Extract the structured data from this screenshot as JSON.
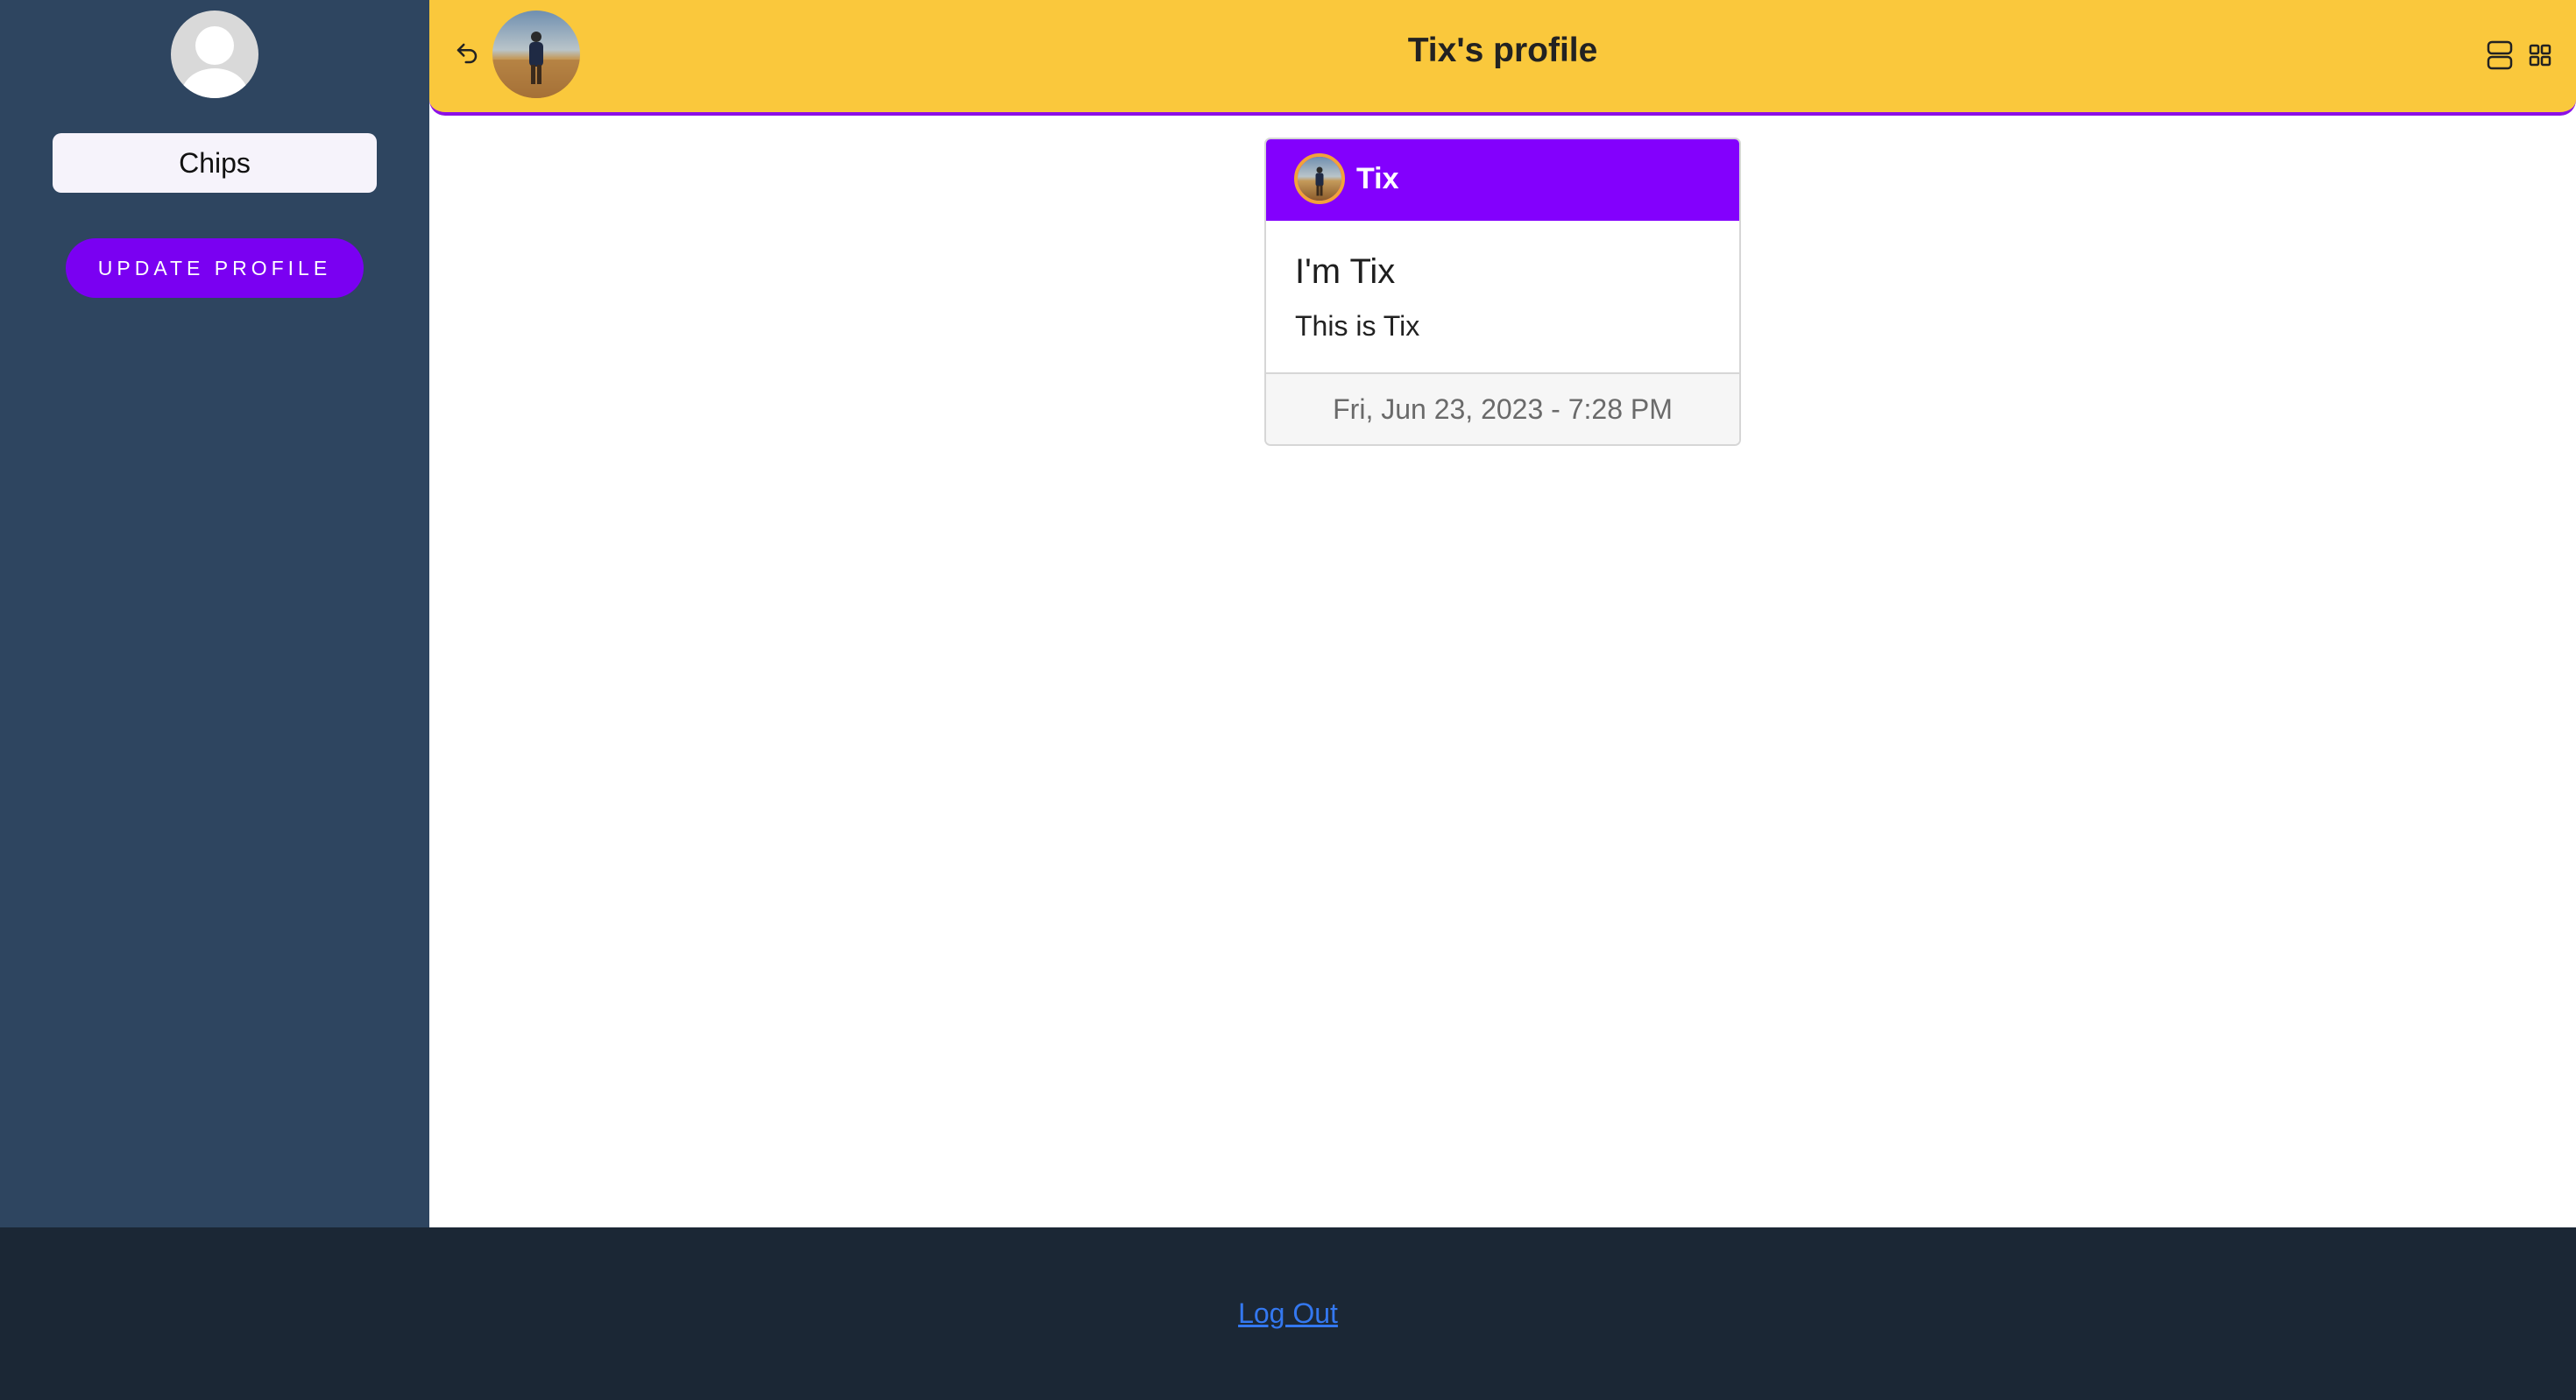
{
  "sidebar": {
    "avatar_icon": "default-user-avatar-icon",
    "name_input_value": "Chips",
    "update_button_label": "UPDATE PROFILE"
  },
  "header": {
    "back_icon": "undo-arrow-icon",
    "title": "Tix's profile",
    "view_icons": [
      "list-view-icon",
      "grid-view-icon"
    ]
  },
  "post": {
    "author": "Tix",
    "title": "I'm Tix",
    "text": "This is Tix",
    "timestamp": "Fri, Jun 23, 2023 - 7:28 PM"
  },
  "footer": {
    "logout_label": "Log Out"
  },
  "colors": {
    "sidebar_bg": "#2e4560",
    "header_bg": "#fac83c",
    "accent_purple": "#8300fd",
    "button_purple": "#7a00f2",
    "footer_bg": "#1b2735",
    "link_blue": "#3478f0"
  }
}
